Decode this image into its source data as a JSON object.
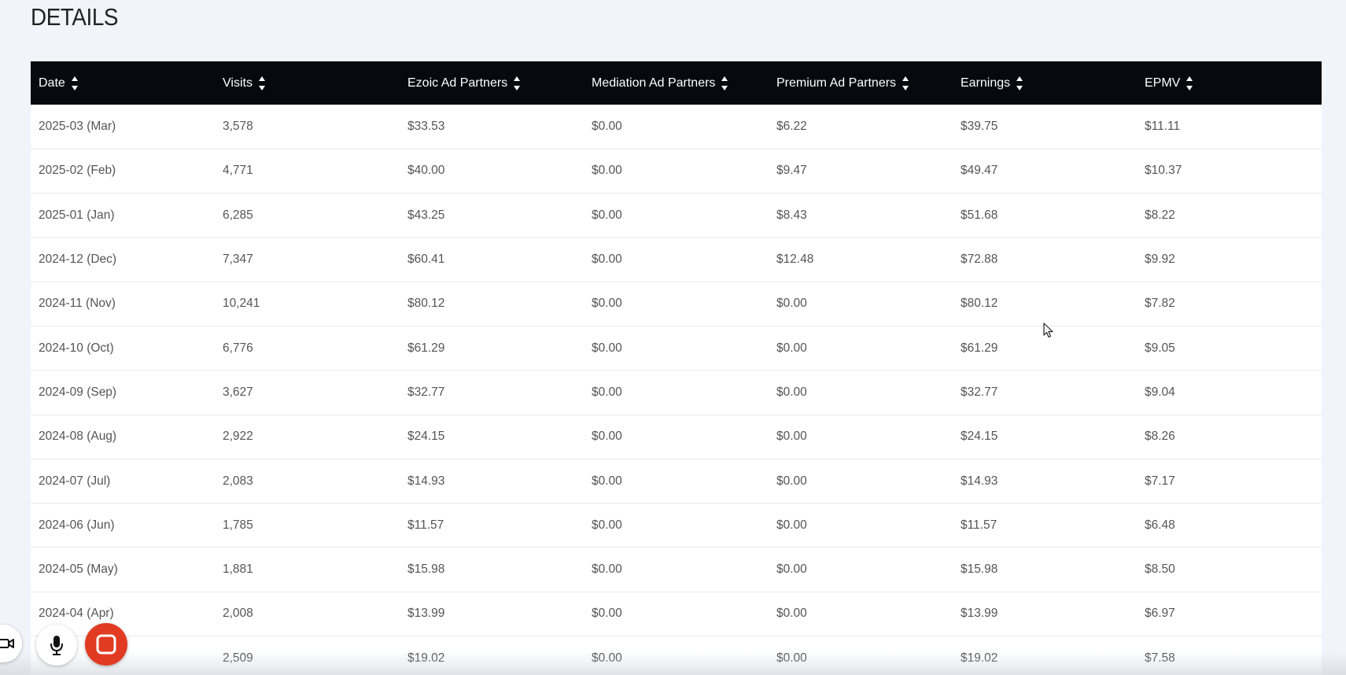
{
  "page": {
    "title": "DETAILS"
  },
  "table": {
    "columns": [
      "Date",
      "Visits",
      "Ezoic Ad Partners",
      "Mediation Ad Partners",
      "Premium Ad Partners",
      "Earnings",
      "EPMV"
    ],
    "rows": [
      [
        "2025-03 (Mar)",
        "3,578",
        "$33.53",
        "$0.00",
        "$6.22",
        "$39.75",
        "$11.11"
      ],
      [
        "2025-02 (Feb)",
        "4,771",
        "$40.00",
        "$0.00",
        "$9.47",
        "$49.47",
        "$10.37"
      ],
      [
        "2025-01 (Jan)",
        "6,285",
        "$43.25",
        "$0.00",
        "$8.43",
        "$51.68",
        "$8.22"
      ],
      [
        "2024-12 (Dec)",
        "7,347",
        "$60.41",
        "$0.00",
        "$12.48",
        "$72.88",
        "$9.92"
      ],
      [
        "2024-11 (Nov)",
        "10,241",
        "$80.12",
        "$0.00",
        "$0.00",
        "$80.12",
        "$7.82"
      ],
      [
        "2024-10 (Oct)",
        "6,776",
        "$61.29",
        "$0.00",
        "$0.00",
        "$61.29",
        "$9.05"
      ],
      [
        "2024-09 (Sep)",
        "3,627",
        "$32.77",
        "$0.00",
        "$0.00",
        "$32.77",
        "$9.04"
      ],
      [
        "2024-08 (Aug)",
        "2,922",
        "$24.15",
        "$0.00",
        "$0.00",
        "$24.15",
        "$8.26"
      ],
      [
        "2024-07 (Jul)",
        "2,083",
        "$14.93",
        "$0.00",
        "$0.00",
        "$14.93",
        "$7.17"
      ],
      [
        "2024-06 (Jun)",
        "1,785",
        "$11.57",
        "$0.00",
        "$0.00",
        "$11.57",
        "$6.48"
      ],
      [
        "2024-05 (May)",
        "1,881",
        "$15.98",
        "$0.00",
        "$0.00",
        "$15.98",
        "$8.50"
      ],
      [
        "2024-04 (Apr)",
        "2,008",
        "$13.99",
        "$0.00",
        "$0.00",
        "$13.99",
        "$6.97"
      ],
      [
        "",
        "2,509",
        "$19.02",
        "$0.00",
        "$0.00",
        "$19.02",
        "$7.58"
      ]
    ]
  },
  "recorder": {
    "icons": [
      "camera-icon",
      "microphone-icon",
      "stop-icon"
    ],
    "stop_color": "#e23b23"
  },
  "colors": {
    "header_bg": "#06090d",
    "page_bg": "#f1f4f8"
  }
}
